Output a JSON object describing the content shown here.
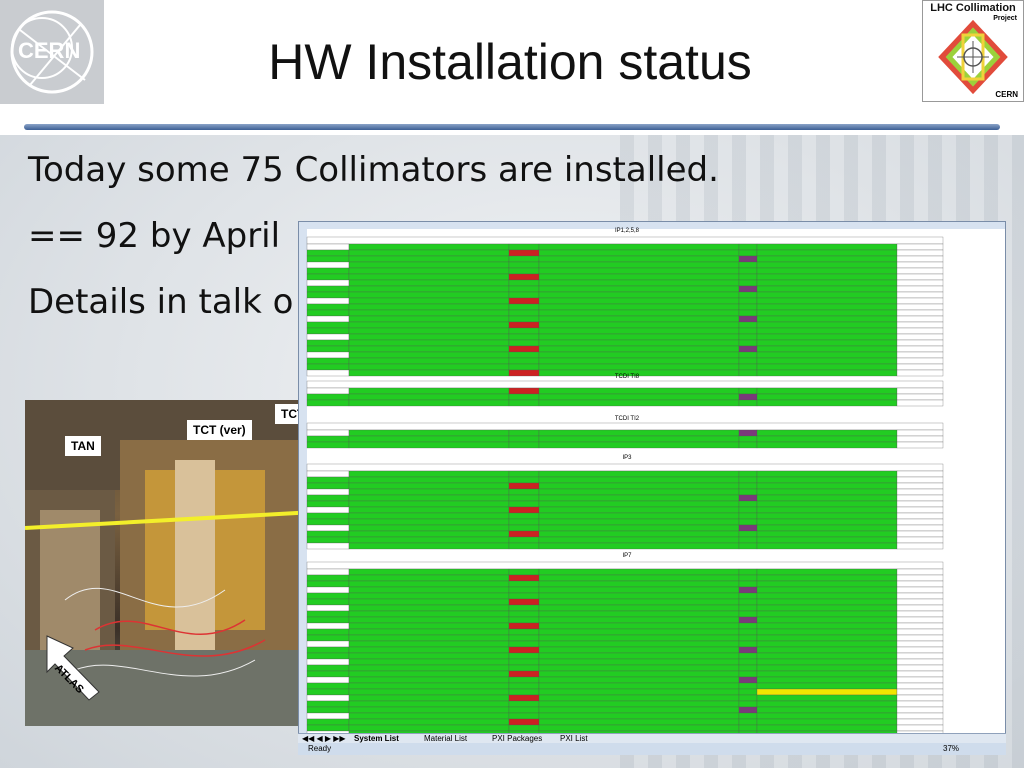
{
  "slide": {
    "title": "HW Installation status",
    "bullets": [
      "Today some 75 Collimators are installed.",
      "== 92 by April",
      "Details in talk o"
    ]
  },
  "logos": {
    "left": "CERN",
    "right_line1": "LHC Collimation",
    "right_line2": "Project",
    "right_line3": "CERN"
  },
  "photo": {
    "labels": [
      "TAN",
      "TCT (ver)",
      "TCT",
      "ATLAS"
    ]
  },
  "spreadsheet": {
    "sections": [
      "IP1,2,5,8",
      "TCDI TI8",
      "TCDI TI2",
      "IP3",
      "IP7"
    ],
    "tabs": [
      "System List",
      "Material List",
      "PXI Packages",
      "PXI List"
    ],
    "status_left": "Ready",
    "zoom": "37%"
  },
  "colors": {
    "title_rule": "#3d5f95",
    "cell_green": "#22cc22",
    "cell_red": "#cc2222",
    "cell_yellow": "#f2e600"
  }
}
